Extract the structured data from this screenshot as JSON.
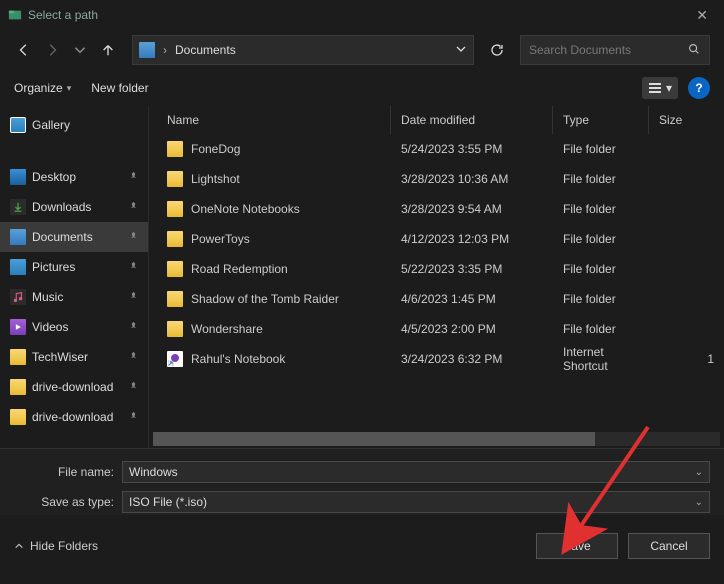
{
  "titlebar": {
    "title": "Select a path"
  },
  "nav": {
    "address_label": "Documents",
    "search_placeholder": "Search Documents"
  },
  "cmdbar": {
    "organize": "Organize",
    "newfolder": "New folder",
    "help": "?"
  },
  "sidebar": {
    "items": [
      {
        "icon": "gallery",
        "label": "Gallery",
        "pin": false
      },
      {
        "icon": "desktop",
        "label": "Desktop",
        "pin": true
      },
      {
        "icon": "down",
        "label": "Downloads",
        "pin": true
      },
      {
        "icon": "doc",
        "label": "Documents",
        "pin": true,
        "selected": true
      },
      {
        "icon": "pic",
        "label": "Pictures",
        "pin": true
      },
      {
        "icon": "music",
        "label": "Music",
        "pin": true
      },
      {
        "icon": "video",
        "label": "Videos",
        "pin": true
      },
      {
        "icon": "folder",
        "label": "TechWiser",
        "pin": true
      },
      {
        "icon": "folder",
        "label": "drive-download",
        "pin": true
      },
      {
        "icon": "folder",
        "label": "drive-download",
        "pin": true
      }
    ]
  },
  "columns": {
    "name": "Name",
    "date": "Date modified",
    "type": "Type",
    "size": "Size"
  },
  "files": [
    {
      "icon": "folder",
      "name": "FoneDog",
      "date": "5/24/2023 3:55 PM",
      "type": "File folder",
      "size": ""
    },
    {
      "icon": "folder",
      "name": "Lightshot",
      "date": "3/28/2023 10:36 AM",
      "type": "File folder",
      "size": ""
    },
    {
      "icon": "folder",
      "name": "OneNote Notebooks",
      "date": "3/28/2023 9:54 AM",
      "type": "File folder",
      "size": ""
    },
    {
      "icon": "folder",
      "name": "PowerToys",
      "date": "4/12/2023 12:03 PM",
      "type": "File folder",
      "size": ""
    },
    {
      "icon": "folder",
      "name": "Road Redemption",
      "date": "5/22/2023 3:35 PM",
      "type": "File folder",
      "size": ""
    },
    {
      "icon": "folder",
      "name": "Shadow of the Tomb Raider",
      "date": "4/6/2023 1:45 PM",
      "type": "File folder",
      "size": ""
    },
    {
      "icon": "folder",
      "name": "Wondershare",
      "date": "4/5/2023 2:00 PM",
      "type": "File folder",
      "size": ""
    },
    {
      "icon": "shortcut",
      "name": "Rahul's Notebook",
      "date": "3/24/2023 6:32 PM",
      "type": "Internet Shortcut",
      "size": "1"
    }
  ],
  "form": {
    "filename_label": "File name:",
    "filename_value": "Windows",
    "type_label": "Save as type:",
    "type_value": "ISO File (*.iso)"
  },
  "bottom": {
    "hide_folders": "Hide Folders",
    "save": "Save",
    "cancel": "Cancel"
  }
}
